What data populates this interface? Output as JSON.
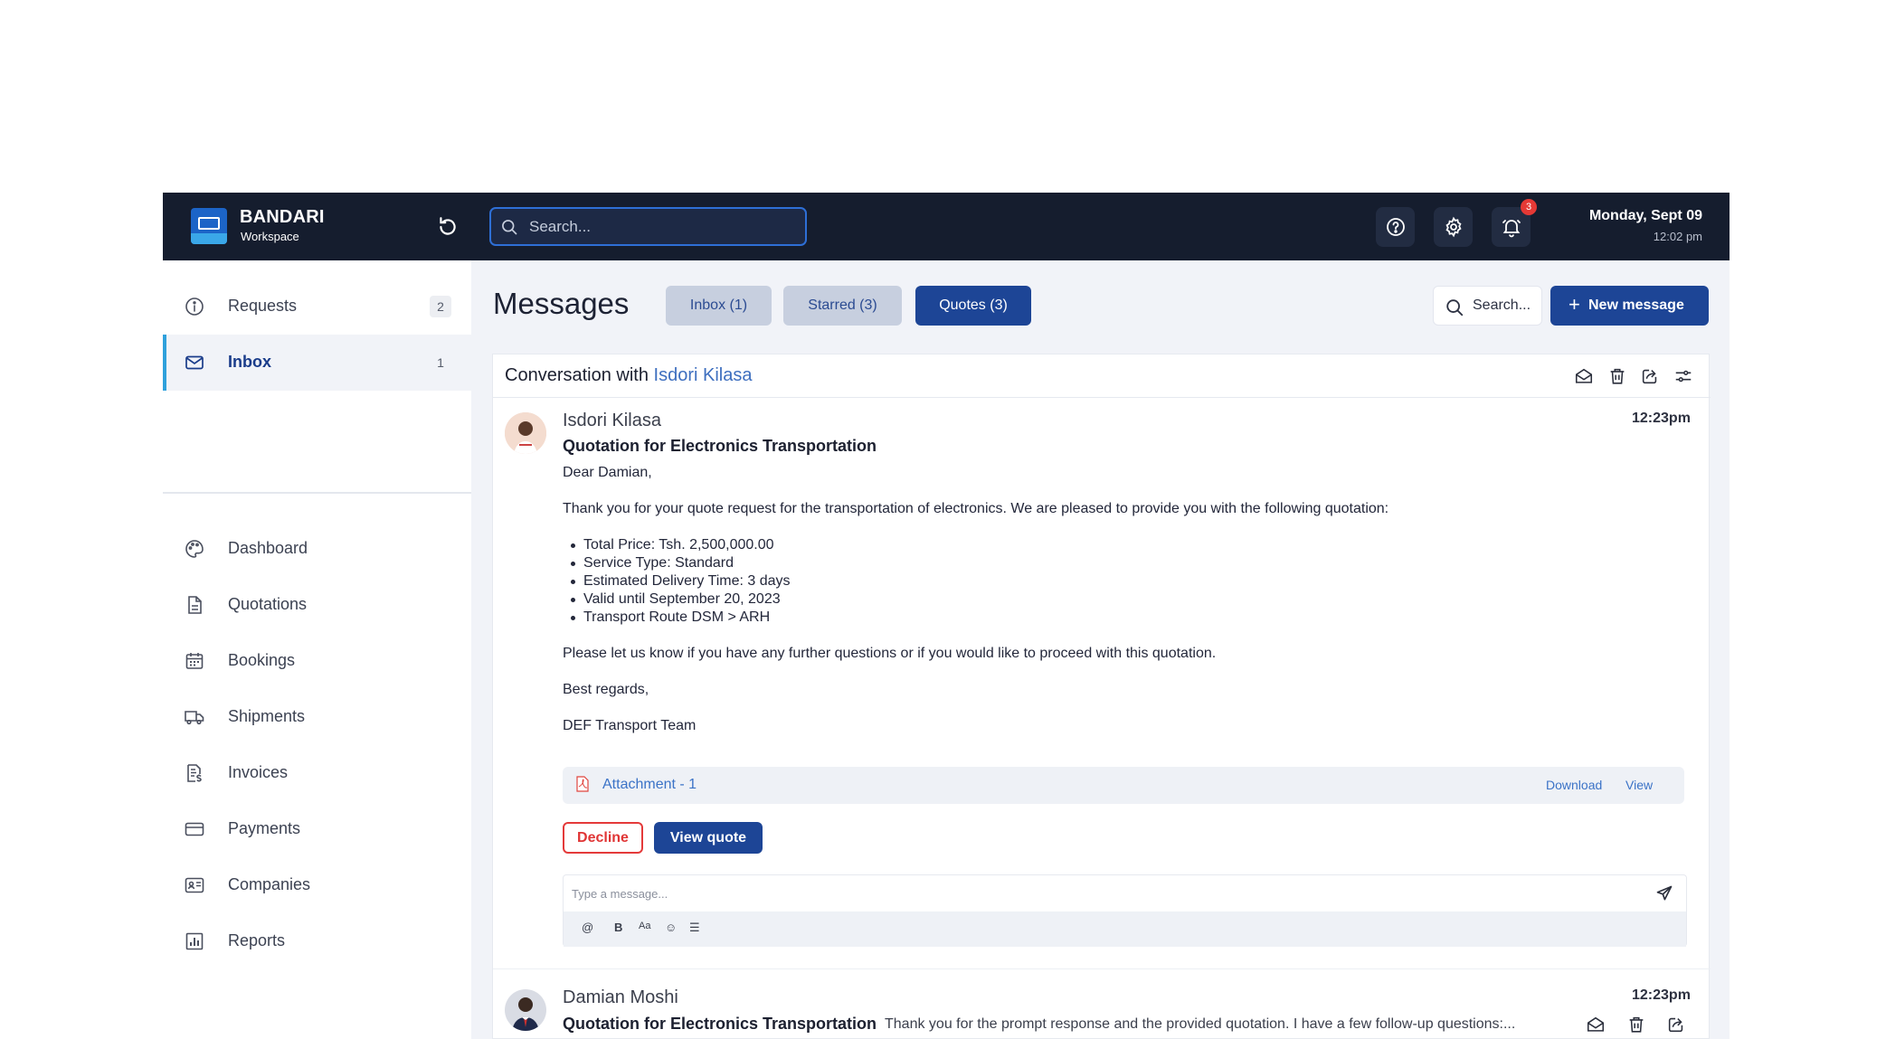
{
  "brand": {
    "name": "BANDARI",
    "sub": "Workspace"
  },
  "topbar": {
    "search_placeholder": "Search...",
    "notification_count": "3",
    "date": "Monday, Sept 09",
    "time": "12:02 pm"
  },
  "sidebar": {
    "top_items": [
      {
        "label": "Requests",
        "count": "2",
        "icon": "info-icon"
      },
      {
        "label": "Inbox",
        "count": "1",
        "icon": "mail-icon"
      }
    ],
    "items": [
      {
        "label": "Dashboard",
        "icon": "palette-icon"
      },
      {
        "label": "Quotations",
        "icon": "document-icon"
      },
      {
        "label": "Bookings",
        "icon": "calendar-icon"
      },
      {
        "label": "Shipments",
        "icon": "truck-icon"
      },
      {
        "label": "Invoices",
        "icon": "invoice-icon"
      },
      {
        "label": "Payments",
        "icon": "credit-card-icon"
      },
      {
        "label": "Companies",
        "icon": "id-card-icon"
      },
      {
        "label": "Reports",
        "icon": "chart-icon"
      }
    ]
  },
  "main": {
    "title": "Messages",
    "tabs": [
      {
        "label": "Inbox (1)"
      },
      {
        "label": "Starred (3)"
      },
      {
        "label": "Quotes (3)"
      }
    ],
    "search_label": "Search...",
    "new_message_label": "New message"
  },
  "conversation": {
    "header_prefix": "Conversation with",
    "header_name": "Isdori Kilasa",
    "message": {
      "sender": "Isdori Kilasa",
      "time": "12:23pm",
      "subject": "Quotation for Electronics Transportation",
      "greeting": "Dear Damian,",
      "intro": "Thank you for your quote request for the transportation of electronics. We are pleased to provide you with the following quotation:",
      "bullets": [
        "Total Price: Tsh. 2,500,000.00",
        "Service Type: Standard",
        "Estimated Delivery Time: 3 days",
        "Valid until September 20, 2023",
        "Transport Route DSM > ARH"
      ],
      "closing": "Please let us know if you have any further questions or if you would like to proceed with this quotation.",
      "regards": "Best regards,",
      "signature": "DEF Transport Team",
      "attachment": {
        "name": "Attachment - 1",
        "download": "Download",
        "view": "View"
      },
      "decline_label": "Decline",
      "view_quote_label": "View quote"
    },
    "composer": {
      "placeholder": "Type a message...",
      "tools": [
        "@",
        "B",
        "Aa",
        "☺",
        "☰"
      ]
    },
    "reply": {
      "sender": "Damian Moshi",
      "time": "12:23pm",
      "subject": "Quotation for Electronics Transportation",
      "preview": "Thank you for the prompt response and the provided quotation. I have a few follow-up questions:..."
    }
  },
  "colors": {
    "topbar_bg": "#151d2e",
    "accent": "#1d4596",
    "link": "#3b73c7",
    "active_bar": "#2fa1dc",
    "danger": "#e43a3a"
  }
}
